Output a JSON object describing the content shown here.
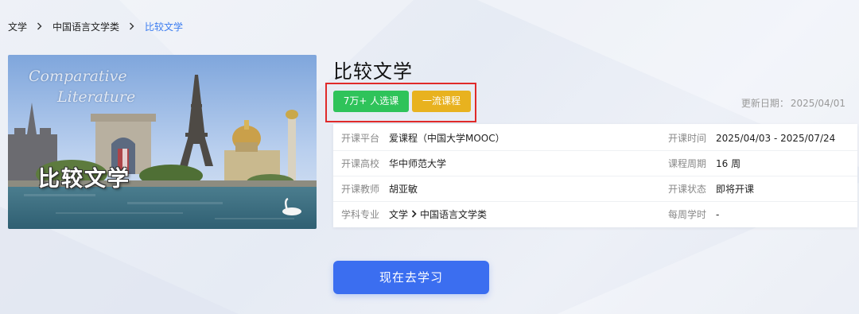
{
  "breadcrumb": {
    "items": [
      "文学",
      "中国语言文学类",
      "比较文学"
    ]
  },
  "cover": {
    "title_en_line1": "Comparative",
    "title_en_line2": "Literature",
    "title_cn": "比较文学"
  },
  "course": {
    "title": "比较文学",
    "tags": [
      "7万+ 人选课",
      "一流课程"
    ],
    "update_label": "更新日期：",
    "update_date": "2025/04/01"
  },
  "info": {
    "rows": [
      {
        "k1": "开课平台",
        "v1": "爱课程（中国大学MOOC）",
        "k2": "开课时间",
        "v2": "2025/04/03 - 2025/07/24"
      },
      {
        "k1": "开课高校",
        "v1": "华中师范大学",
        "k2": "课程周期",
        "v2": "16 周"
      },
      {
        "k1": "开课教师",
        "v1": "胡亚敏",
        "k2": "开课状态",
        "v2": "即将开课"
      },
      {
        "k1": "学科专业",
        "v1_a": "文学",
        "v1_b": "中国语言文学类",
        "k2": "每周学时",
        "v2": "-"
      }
    ]
  },
  "cta": {
    "label": "现在去学习"
  },
  "colors": {
    "accent": "#3b6ef0",
    "breadcrumb_active": "#3b7cf0",
    "tag_green": "#2fc35a",
    "tag_yellow": "#e8b21f",
    "highlight_border": "#e02a2a"
  },
  "icons": [
    "chevron-right-icon"
  ]
}
